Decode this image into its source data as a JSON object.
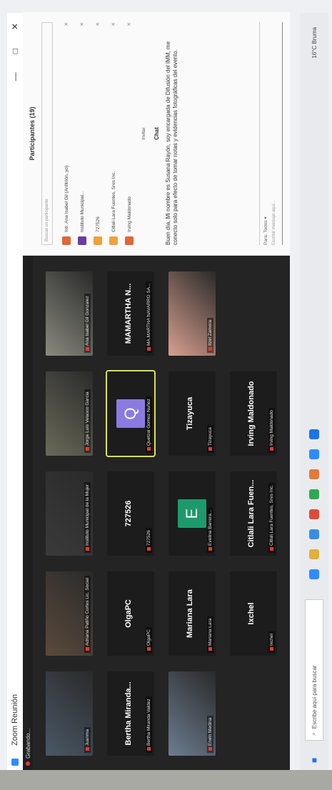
{
  "window": {
    "title": "Zoom Reunión",
    "controls": [
      "—",
      "□",
      "✕"
    ]
  },
  "recording": {
    "label": "Grabando..."
  },
  "tiles": [
    {
      "id": "t1",
      "name": "Juanma",
      "kind": "camera",
      "color": "#4a5866"
    },
    {
      "id": "t2",
      "name": "Adriana Patiño Cortes Lic. Social",
      "kind": "camera",
      "color": "#5a4a3c"
    },
    {
      "id": "t3",
      "name": "Instituto Municipal de la Mujer",
      "kind": "camera",
      "color": "#3a3a3a"
    },
    {
      "id": "t4",
      "name": "Jorge Luis Velasco Garcia",
      "kind": "camera",
      "color": "#6a6a5a"
    },
    {
      "id": "t5",
      "name": "Ana Isabel Gil Gonzalez",
      "kind": "camera",
      "color": "#8a8a80"
    },
    {
      "id": "t6",
      "big": "Bertha  Miranda...",
      "name": "Bertha Miranda Valdez",
      "kind": "name"
    },
    {
      "id": "t7",
      "big": "OlgaPC",
      "name": "OlgaPC",
      "kind": "name"
    },
    {
      "id": "t8",
      "big": "727526",
      "name": "727526",
      "kind": "name"
    },
    {
      "id": "t9",
      "name": "Quetzal Gomez Nuñez",
      "kind": "avatar",
      "letter": "Q",
      "color": "#8b7be0",
      "active": true
    },
    {
      "id": "t10",
      "big": "MAMARTHA  N...",
      "name": "MA.MARTHA NAVARRO SA...",
      "kind": "name"
    },
    {
      "id": "t11",
      "name": "Erwin Medina",
      "kind": "camera",
      "color": "#6d7d90"
    },
    {
      "id": "t12",
      "big": "Mariana Lara",
      "name": "Mariana Lara",
      "kind": "name"
    },
    {
      "id": "t13",
      "name": "Evelina Barrera...",
      "kind": "avatar",
      "letter": "E",
      "color": "#1d9a6c"
    },
    {
      "id": "t14",
      "big": "Tizayuca",
      "name": "Tizayuca",
      "kind": "name"
    },
    {
      "id": "t15",
      "name": "Itzel Zamora",
      "kind": "camera",
      "color": "#d9a090"
    },
    {
      "id": "t16",
      "big": "Ixchel",
      "name": "Ixchel",
      "kind": "name"
    },
    {
      "id": "t17",
      "big": "Citlali Lara Fuen...",
      "name": "Citlali Lara Fuentes, Sres Inc.",
      "kind": "name"
    },
    {
      "id": "t18",
      "big": "Irving Maldonado",
      "name": "Irving Maldonado",
      "kind": "name"
    }
  ],
  "panel": {
    "participants_title": "Participantes (19)",
    "search_placeholder": "Buscar un participante",
    "participants": [
      {
        "name": "Intr. Ana Isabel Gil (Anfitrión, yo)",
        "color": "#e0673a"
      },
      {
        "name": "Instituto Municipal...",
        "color": "#6a3da0"
      },
      {
        "name": "727526",
        "color": "#f0a23a"
      },
      {
        "name": "Citlali Lara Fuentes, Sres Inc.",
        "color": "#f0a23a"
      },
      {
        "name": "Irving Maldonado",
        "color": "#e0673a"
      }
    ],
    "invite_label": "Invitar",
    "chat_title": "Chat",
    "chat_message": "Buen día, Mi nombre es Susana Rayón, soy encargada de Difusión del IMM, me conecto solo para efecto de tomar notas y evidencias fotográficas del evento.",
    "chat_to": "Para: Todos ▾",
    "chat_placeholder": "Escribir mensaje aquí..."
  },
  "taskbar": {
    "search_placeholder": "Escribe aquí para buscar",
    "tray_text": "16°C Bruma",
    "icons": [
      "#2d8cff",
      "#e0b03a",
      "#3a8ee0",
      "#e04a3a",
      "#31a852",
      "#e07a3a",
      "#2d8cff",
      "#1a73e8"
    ]
  }
}
